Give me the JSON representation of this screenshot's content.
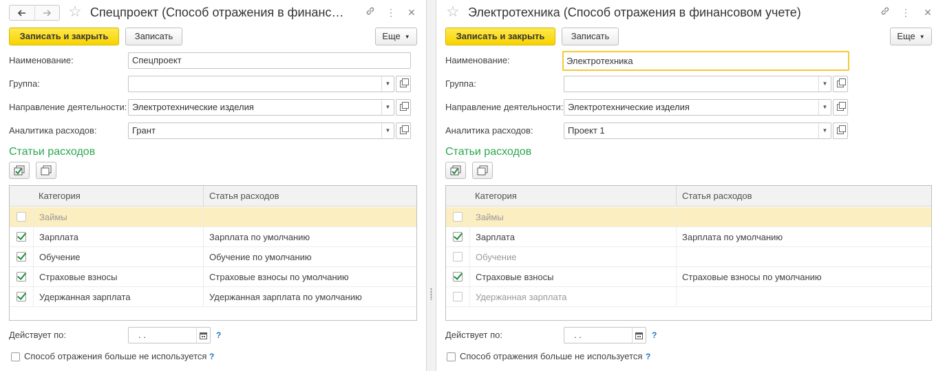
{
  "left": {
    "title": "Спецпроект (Способ отражения в финанс…",
    "toolbar": {
      "save_close": "Записать и закрыть",
      "save": "Записать",
      "more": "Еще"
    },
    "fields": {
      "name_label": "Наименование:",
      "name_value": "Спецпроект",
      "group_label": "Группа:",
      "group_value": "",
      "direction_label": "Направление деятельности:",
      "direction_value": "Электротехнические изделия",
      "analytics_label": "Аналитика расходов:",
      "analytics_value": "Грант"
    },
    "section_title": "Статьи расходов",
    "table": {
      "col_category": "Категория",
      "col_item": "Статья расходов",
      "rows": [
        {
          "checked": false,
          "category": "Займы",
          "item": "",
          "muted": true,
          "selected": true
        },
        {
          "checked": true,
          "category": "Зарплата",
          "item": "Зарплата по умолчанию"
        },
        {
          "checked": true,
          "category": "Обучение",
          "item": "Обучение по умолчанию"
        },
        {
          "checked": true,
          "category": "Страховые взносы",
          "item": "Страховые взносы по умолчанию"
        },
        {
          "checked": true,
          "category": "Удержанная зарплата",
          "item": "Удержанная зарплата по умолчанию"
        }
      ]
    },
    "valid_label": "Действует по:",
    "valid_value": ". .",
    "help": "?",
    "unused_label": "Способ отражения больше не используется"
  },
  "right": {
    "title": "Электротехника (Способ отражения в финансовом учете)",
    "toolbar": {
      "save_close": "Записать и закрыть",
      "save": "Записать",
      "more": "Еще"
    },
    "fields": {
      "name_label": "Наименование:",
      "name_value": "Электротехника",
      "group_label": "Группа:",
      "group_value": "",
      "direction_label": "Направление деятельности:",
      "direction_value": "Электротехнические изделия",
      "analytics_label": "Аналитика расходов:",
      "analytics_value": "Проект 1"
    },
    "section_title": "Статьи расходов",
    "table": {
      "col_category": "Категория",
      "col_item": "Статья расходов",
      "rows": [
        {
          "checked": false,
          "category": "Займы",
          "item": "",
          "muted": true,
          "selected": true
        },
        {
          "checked": true,
          "category": "Зарплата",
          "item": "Зарплата по умолчанию"
        },
        {
          "checked": false,
          "category": "Обучение",
          "item": "",
          "muted": true
        },
        {
          "checked": true,
          "category": "Страховые взносы",
          "item": "Страховые взносы по умолчанию"
        },
        {
          "checked": false,
          "category": "Удержанная зарплата",
          "item": "",
          "muted": true
        }
      ]
    },
    "valid_label": "Действует по:",
    "valid_value": ". .",
    "help": "?",
    "unused_label": "Способ отражения больше не используется"
  }
}
